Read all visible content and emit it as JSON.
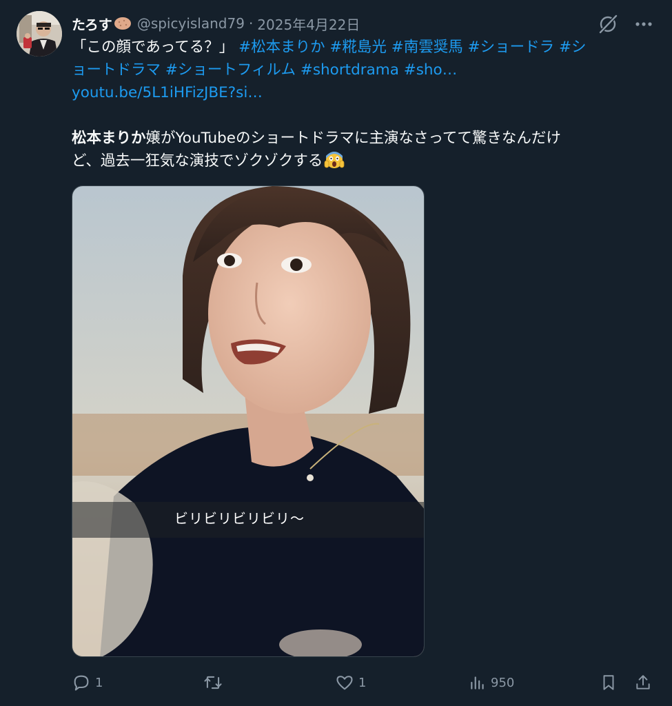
{
  "author": {
    "display_name": "たろす",
    "name_emoji": "potato-emoji",
    "handle": "@spicyisland79",
    "separator": "·",
    "date": "2025年4月22日"
  },
  "header_actions": {
    "grok_icon": "grok-icon",
    "more_icon": "more-icon"
  },
  "post": {
    "line1_text": "「この顔であってる？」",
    "line1_tags": "#松本まりか #糀島光 #南雲奨馬 #ショードラ #シ",
    "line2_tags": "ョートドラマ #ショートフィルム #shortdrama #sho…",
    "url": "youtu.be/5L1iHFizJBE?si…",
    "para_bold": "松本まりか",
    "para_rest1": "嬢がYouTubeのショートドラマに主演なさってて驚きなんだけ",
    "para_line2": "ど、過去一狂気な演技でゾクゾクする",
    "emoji": "scream-emoji"
  },
  "media": {
    "subtitle": "ビリビリビリビリ〜"
  },
  "actions": {
    "reply_count": "1",
    "repost_count": "",
    "like_count": "1",
    "views_count": "950"
  },
  "colors": {
    "background": "#15202b",
    "text": "#f7f9f9",
    "secondary": "#8b98a5",
    "link": "#1d9bf0"
  }
}
